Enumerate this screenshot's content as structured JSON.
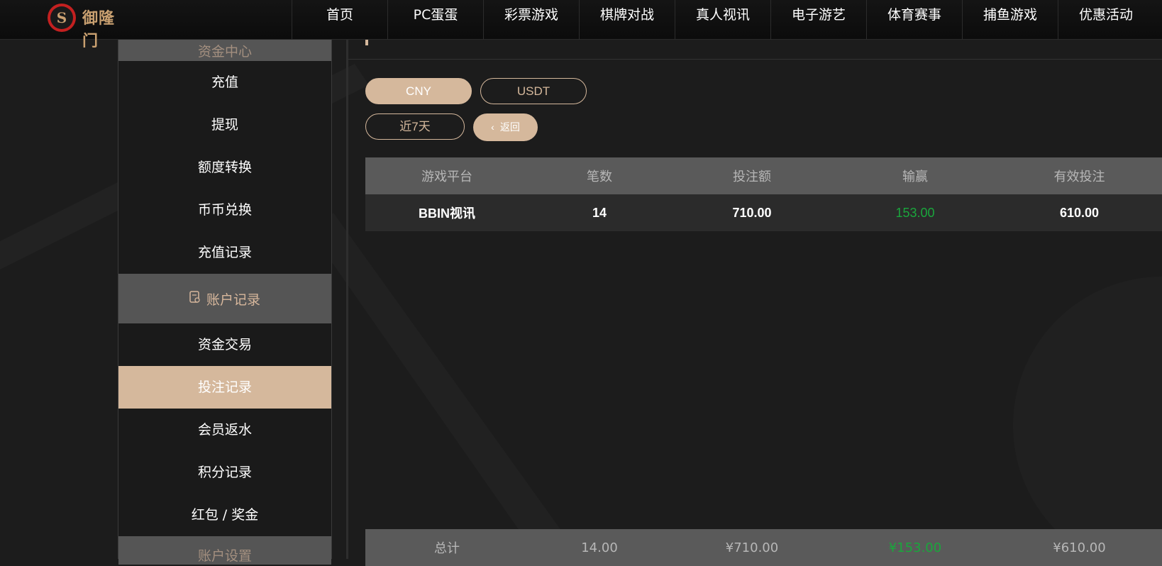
{
  "brand": {
    "logo_text": "御隆门",
    "logo_icon": "brand-logo-icon"
  },
  "nav": {
    "items": [
      "首页",
      "PC蛋蛋",
      "彩票游戏",
      "棋牌对战",
      "真人视讯",
      "电子游艺",
      "体育赛事",
      "捕鱼游戏",
      "优惠活动"
    ]
  },
  "sidebar": {
    "group_top_label": "资金中心",
    "items_top": [
      "充值",
      "提现",
      "额度转换",
      "币币兑换",
      "充值记录"
    ],
    "group_records": {
      "label": "账户记录",
      "icon": "document-icon"
    },
    "items_records": [
      "资金交易",
      "投注记录",
      "会员返水",
      "积分记录",
      "红包 / 奖金"
    ],
    "active_item": "投注记录",
    "group_bottom_label": "账户设置"
  },
  "filters": {
    "currency_cny": "CNY",
    "currency_usdt": "USDT",
    "range": "近7天",
    "back": "返回"
  },
  "table": {
    "columns": [
      "游戏平台",
      "笔数",
      "投注额",
      "输赢",
      "有效投注"
    ],
    "rows": [
      {
        "platform": "BBIN视讯",
        "count": "14",
        "bet": "710.00",
        "winloss": "153.00",
        "valid": "610.00"
      }
    ],
    "total": {
      "label": "总计",
      "count": "14.00",
      "bet": "¥710.00",
      "winloss": "¥153.00",
      "valid": "¥610.00"
    }
  },
  "colors": {
    "accent": "#d5b89c",
    "win": "#1aa63c",
    "header_bg": "#5a5a5a"
  }
}
